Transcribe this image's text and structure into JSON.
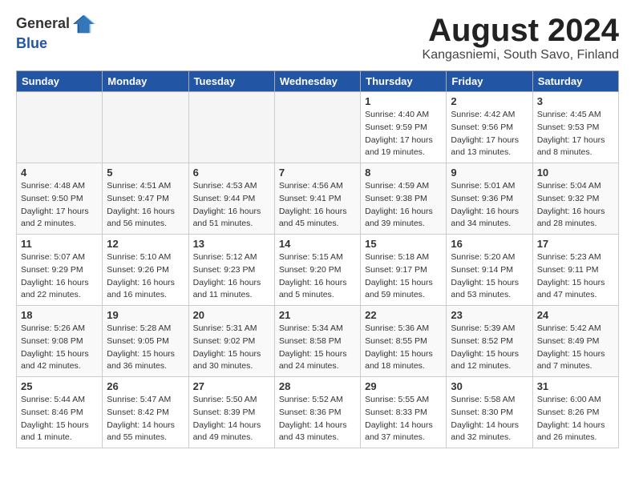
{
  "header": {
    "logo_general": "General",
    "logo_blue": "Blue",
    "title": "August 2024",
    "location": "Kangasniemi, South Savo, Finland"
  },
  "days_of_week": [
    "Sunday",
    "Monday",
    "Tuesday",
    "Wednesday",
    "Thursday",
    "Friday",
    "Saturday"
  ],
  "weeks": [
    [
      {
        "day": "",
        "empty": true
      },
      {
        "day": "",
        "empty": true
      },
      {
        "day": "",
        "empty": true
      },
      {
        "day": "",
        "empty": true
      },
      {
        "day": "1",
        "sunrise": "4:40 AM",
        "sunset": "9:59 PM",
        "daylight": "17 hours and 19 minutes."
      },
      {
        "day": "2",
        "sunrise": "4:42 AM",
        "sunset": "9:56 PM",
        "daylight": "17 hours and 13 minutes."
      },
      {
        "day": "3",
        "sunrise": "4:45 AM",
        "sunset": "9:53 PM",
        "daylight": "17 hours and 8 minutes."
      }
    ],
    [
      {
        "day": "4",
        "sunrise": "4:48 AM",
        "sunset": "9:50 PM",
        "daylight": "17 hours and 2 minutes."
      },
      {
        "day": "5",
        "sunrise": "4:51 AM",
        "sunset": "9:47 PM",
        "daylight": "16 hours and 56 minutes."
      },
      {
        "day": "6",
        "sunrise": "4:53 AM",
        "sunset": "9:44 PM",
        "daylight": "16 hours and 51 minutes."
      },
      {
        "day": "7",
        "sunrise": "4:56 AM",
        "sunset": "9:41 PM",
        "daylight": "16 hours and 45 minutes."
      },
      {
        "day": "8",
        "sunrise": "4:59 AM",
        "sunset": "9:38 PM",
        "daylight": "16 hours and 39 minutes."
      },
      {
        "day": "9",
        "sunrise": "5:01 AM",
        "sunset": "9:36 PM",
        "daylight": "16 hours and 34 minutes."
      },
      {
        "day": "10",
        "sunrise": "5:04 AM",
        "sunset": "9:32 PM",
        "daylight": "16 hours and 28 minutes."
      }
    ],
    [
      {
        "day": "11",
        "sunrise": "5:07 AM",
        "sunset": "9:29 PM",
        "daylight": "16 hours and 22 minutes."
      },
      {
        "day": "12",
        "sunrise": "5:10 AM",
        "sunset": "9:26 PM",
        "daylight": "16 hours and 16 minutes."
      },
      {
        "day": "13",
        "sunrise": "5:12 AM",
        "sunset": "9:23 PM",
        "daylight": "16 hours and 11 minutes."
      },
      {
        "day": "14",
        "sunrise": "5:15 AM",
        "sunset": "9:20 PM",
        "daylight": "16 hours and 5 minutes."
      },
      {
        "day": "15",
        "sunrise": "5:18 AM",
        "sunset": "9:17 PM",
        "daylight": "15 hours and 59 minutes."
      },
      {
        "day": "16",
        "sunrise": "5:20 AM",
        "sunset": "9:14 PM",
        "daylight": "15 hours and 53 minutes."
      },
      {
        "day": "17",
        "sunrise": "5:23 AM",
        "sunset": "9:11 PM",
        "daylight": "15 hours and 47 minutes."
      }
    ],
    [
      {
        "day": "18",
        "sunrise": "5:26 AM",
        "sunset": "9:08 PM",
        "daylight": "15 hours and 42 minutes."
      },
      {
        "day": "19",
        "sunrise": "5:28 AM",
        "sunset": "9:05 PM",
        "daylight": "15 hours and 36 minutes."
      },
      {
        "day": "20",
        "sunrise": "5:31 AM",
        "sunset": "9:02 PM",
        "daylight": "15 hours and 30 minutes."
      },
      {
        "day": "21",
        "sunrise": "5:34 AM",
        "sunset": "8:58 PM",
        "daylight": "15 hours and 24 minutes."
      },
      {
        "day": "22",
        "sunrise": "5:36 AM",
        "sunset": "8:55 PM",
        "daylight": "15 hours and 18 minutes."
      },
      {
        "day": "23",
        "sunrise": "5:39 AM",
        "sunset": "8:52 PM",
        "daylight": "15 hours and 12 minutes."
      },
      {
        "day": "24",
        "sunrise": "5:42 AM",
        "sunset": "8:49 PM",
        "daylight": "15 hours and 7 minutes."
      }
    ],
    [
      {
        "day": "25",
        "sunrise": "5:44 AM",
        "sunset": "8:46 PM",
        "daylight": "15 hours and 1 minute."
      },
      {
        "day": "26",
        "sunrise": "5:47 AM",
        "sunset": "8:42 PM",
        "daylight": "14 hours and 55 minutes."
      },
      {
        "day": "27",
        "sunrise": "5:50 AM",
        "sunset": "8:39 PM",
        "daylight": "14 hours and 49 minutes."
      },
      {
        "day": "28",
        "sunrise": "5:52 AM",
        "sunset": "8:36 PM",
        "daylight": "14 hours and 43 minutes."
      },
      {
        "day": "29",
        "sunrise": "5:55 AM",
        "sunset": "8:33 PM",
        "daylight": "14 hours and 37 minutes."
      },
      {
        "day": "30",
        "sunrise": "5:58 AM",
        "sunset": "8:30 PM",
        "daylight": "14 hours and 32 minutes."
      },
      {
        "day": "31",
        "sunrise": "6:00 AM",
        "sunset": "8:26 PM",
        "daylight": "14 hours and 26 minutes."
      }
    ]
  ]
}
